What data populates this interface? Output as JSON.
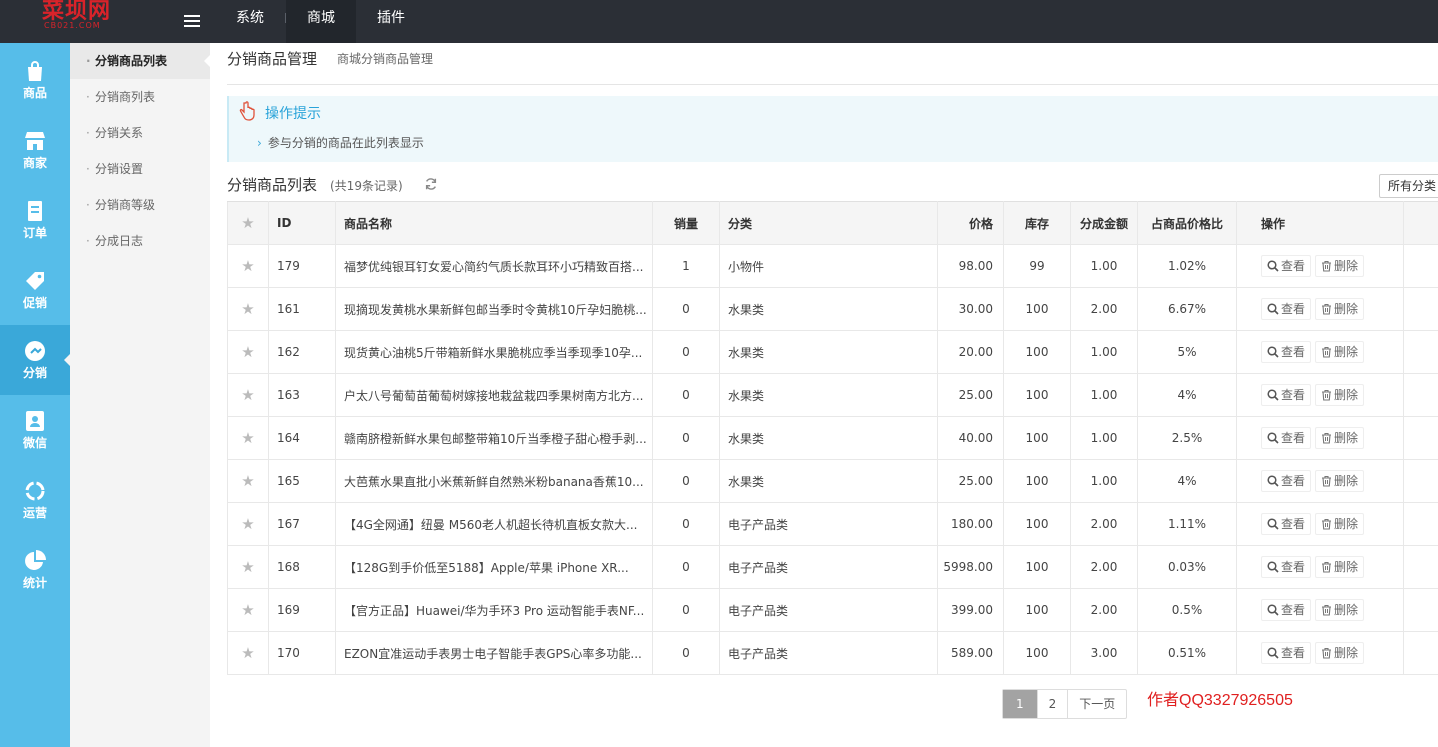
{
  "topbar": {
    "logo_cn": "菜坝网",
    "logo_en": "CB021.COM",
    "nav": [
      {
        "label": "系统"
      },
      {
        "label": "商城"
      },
      {
        "label": "插件"
      }
    ]
  },
  "leftbar": {
    "items": [
      {
        "label": "商品",
        "icon": "bag-icon"
      },
      {
        "label": "商家",
        "icon": "store-icon"
      },
      {
        "label": "订单",
        "icon": "order-icon"
      },
      {
        "label": "促销",
        "icon": "tag-icon"
      },
      {
        "label": "分销",
        "icon": "distribution-icon"
      },
      {
        "label": "微信",
        "icon": "wechat-icon"
      },
      {
        "label": "运营",
        "icon": "operation-icon"
      },
      {
        "label": "统计",
        "icon": "pie-chart-icon"
      }
    ],
    "active": "分销"
  },
  "subside": {
    "items": [
      {
        "label": "分销商品列表"
      },
      {
        "label": "分销商列表"
      },
      {
        "label": "分销关系"
      },
      {
        "label": "分销设置"
      },
      {
        "label": "分销商等级"
      },
      {
        "label": "分成日志"
      }
    ]
  },
  "page": {
    "title": "分销商品管理",
    "subtitle": "商城分销商品管理"
  },
  "tips": {
    "title": "操作提示",
    "text": "参与分销的商品在此列表显示"
  },
  "list": {
    "title": "分销商品列表",
    "count": "(共19条记录)",
    "category_select": "所有分类"
  },
  "table": {
    "headers": [
      "ID",
      "商品名称",
      "销量",
      "分类",
      "价格",
      "库存",
      "分成金额",
      "占商品价格比",
      "操作"
    ],
    "view_label": "查看",
    "delete_label": "删除",
    "rows": [
      {
        "id": "179",
        "name": "福梦优纯银耳钉女爱心简约气质长款耳环小巧精致百搭...",
        "sales": "1",
        "cat": "小物件",
        "price": "98.00",
        "stock": "99",
        "comm": "1.00",
        "ratio": "1.02%"
      },
      {
        "id": "161",
        "name": "现摘现发黄桃水果新鲜包邮当季时令黄桃10斤孕妇脆桃...",
        "sales": "0",
        "cat": "水果类",
        "price": "30.00",
        "stock": "100",
        "comm": "2.00",
        "ratio": "6.67%"
      },
      {
        "id": "162",
        "name": "现货黄心油桃5斤带箱新鲜水果脆桃应季当季现季10孕...",
        "sales": "0",
        "cat": "水果类",
        "price": "20.00",
        "stock": "100",
        "comm": "1.00",
        "ratio": "5%"
      },
      {
        "id": "163",
        "name": "户太八号葡萄苗葡萄树嫁接地栽盆栽四季果树南方北方...",
        "sales": "0",
        "cat": "水果类",
        "price": "25.00",
        "stock": "100",
        "comm": "1.00",
        "ratio": "4%"
      },
      {
        "id": "164",
        "name": "赣南脐橙新鲜水果包邮整带箱10斤当季橙子甜心橙手剥...",
        "sales": "0",
        "cat": "水果类",
        "price": "40.00",
        "stock": "100",
        "comm": "1.00",
        "ratio": "2.5%"
      },
      {
        "id": "165",
        "name": "大芭蕉水果直批小米蕉新鲜自然熟米粉banana香蕉10...",
        "sales": "0",
        "cat": "水果类",
        "price": "25.00",
        "stock": "100",
        "comm": "1.00",
        "ratio": "4%"
      },
      {
        "id": "167",
        "name": "【4G全网通】纽曼 M560老人机超长待机直板女款大...",
        "sales": "0",
        "cat": "电子产品类",
        "price": "180.00",
        "stock": "100",
        "comm": "2.00",
        "ratio": "1.11%"
      },
      {
        "id": "168",
        "name": "【128G到手价低至5188】Apple/苹果 iPhone XR...",
        "sales": "0",
        "cat": "电子产品类",
        "price": "5998.00",
        "stock": "100",
        "comm": "2.00",
        "ratio": "0.03%"
      },
      {
        "id": "169",
        "name": "【官方正品】Huawei/华为手环3 Pro 运动智能手表NF...",
        "sales": "0",
        "cat": "电子产品类",
        "price": "399.00",
        "stock": "100",
        "comm": "2.00",
        "ratio": "0.5%"
      },
      {
        "id": "170",
        "name": "EZON宜准运动手表男士电子智能手表GPS心率多功能...",
        "sales": "0",
        "cat": "电子产品类",
        "price": "589.00",
        "stock": "100",
        "comm": "3.00",
        "ratio": "0.51%"
      }
    ]
  },
  "pager": {
    "pages": [
      "1",
      "2"
    ],
    "next": "下一页"
  },
  "author": "作者QQ3327926505"
}
